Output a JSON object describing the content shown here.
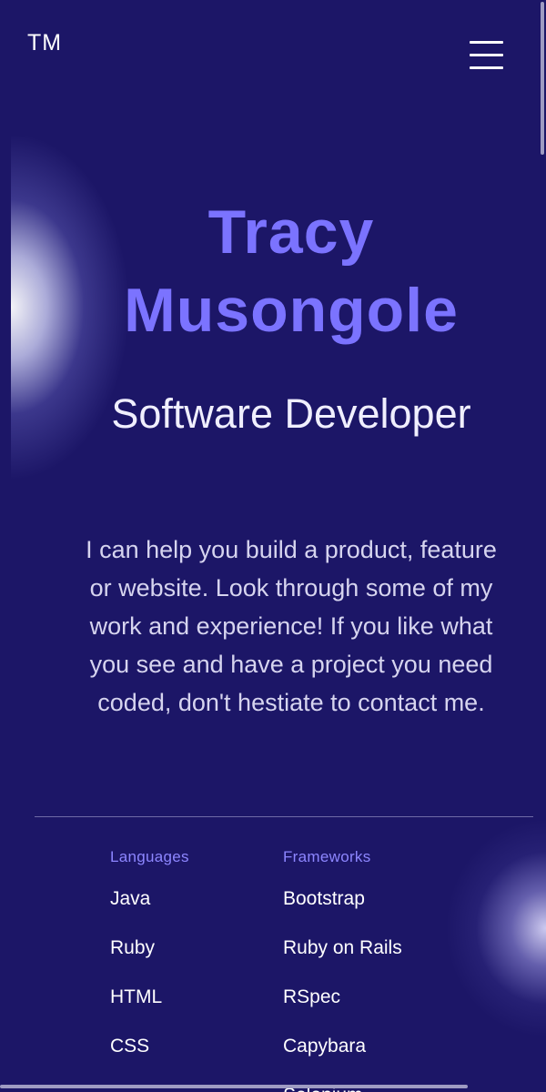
{
  "header": {
    "logo_text": "TM",
    "menu_icon": "hamburger-menu-icon"
  },
  "hero": {
    "name_line1": "Tracy",
    "name_line2": "Musongole",
    "role": "Software Developer",
    "intro": "I can help you build a product, feature or website. Look through some of my work and experience! If you like what you see and have a project you need coded, don't hestiate to contact me."
  },
  "skills": {
    "languages": {
      "heading": "Languages",
      "items": [
        "Java",
        "Ruby",
        "HTML",
        "CSS"
      ]
    },
    "frameworks": {
      "heading": "Frameworks",
      "items": [
        "Bootstrap",
        "Ruby on Rails",
        "RSpec",
        "Capybara",
        "Selenium"
      ]
    }
  },
  "colors": {
    "background": "#1c1667",
    "accent": "#7b73ff",
    "heading_accent": "#8d86ff",
    "text_light": "#f0efff"
  }
}
